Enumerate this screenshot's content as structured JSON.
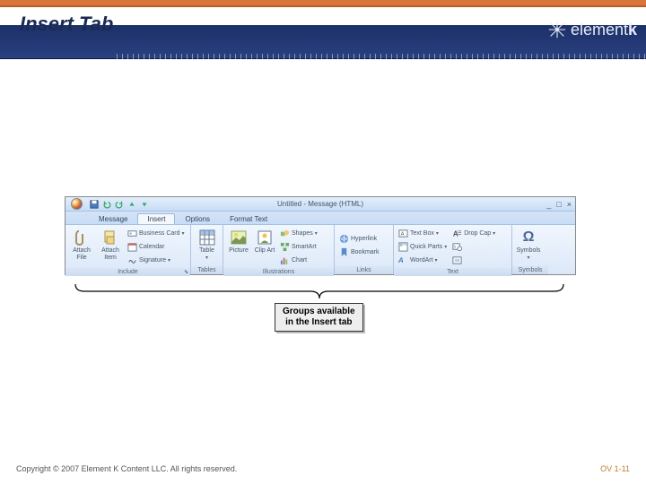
{
  "header": {
    "title": "Insert Tab",
    "logo_text": "element",
    "logo_suffix": "k"
  },
  "ribbon": {
    "window_title": "Untitled - Message (HTML)",
    "qat": [
      "save",
      "undo",
      "redo",
      "prev",
      "next"
    ],
    "tabs": [
      {
        "label": "Message",
        "active": false
      },
      {
        "label": "Insert",
        "active": true
      },
      {
        "label": "Options",
        "active": false
      },
      {
        "label": "Format Text",
        "active": false
      }
    ],
    "groups": {
      "include": {
        "label": "Include",
        "attach_file": "Attach File",
        "attach_item": "Attach Item",
        "business_card": "Business Card",
        "calendar": "Calendar",
        "signature": "Signature"
      },
      "tables": {
        "label": "Tables",
        "table": "Table"
      },
      "illustrations": {
        "label": "Illustrations",
        "picture": "Picture",
        "clip_art": "Clip Art",
        "shapes": "Shapes",
        "smartart": "SmartArt",
        "chart": "Chart"
      },
      "links": {
        "label": "Links",
        "hyperlink": "Hyperlink",
        "bookmark": "Bookmark"
      },
      "text": {
        "label": "Text",
        "text_box": "Text Box",
        "quick_parts": "Quick Parts",
        "wordart": "WordArt",
        "drop_cap": "Drop Cap",
        "date_time": "",
        "object": ""
      },
      "symbols": {
        "label": "Symbols",
        "symbols": "Symbols"
      }
    }
  },
  "callout": {
    "line1": "Groups available",
    "line2": "in the Insert tab"
  },
  "footer": {
    "copyright": "Copyright © 2007 Element K Content LLC. All rights reserved.",
    "page": "OV 1-11"
  }
}
